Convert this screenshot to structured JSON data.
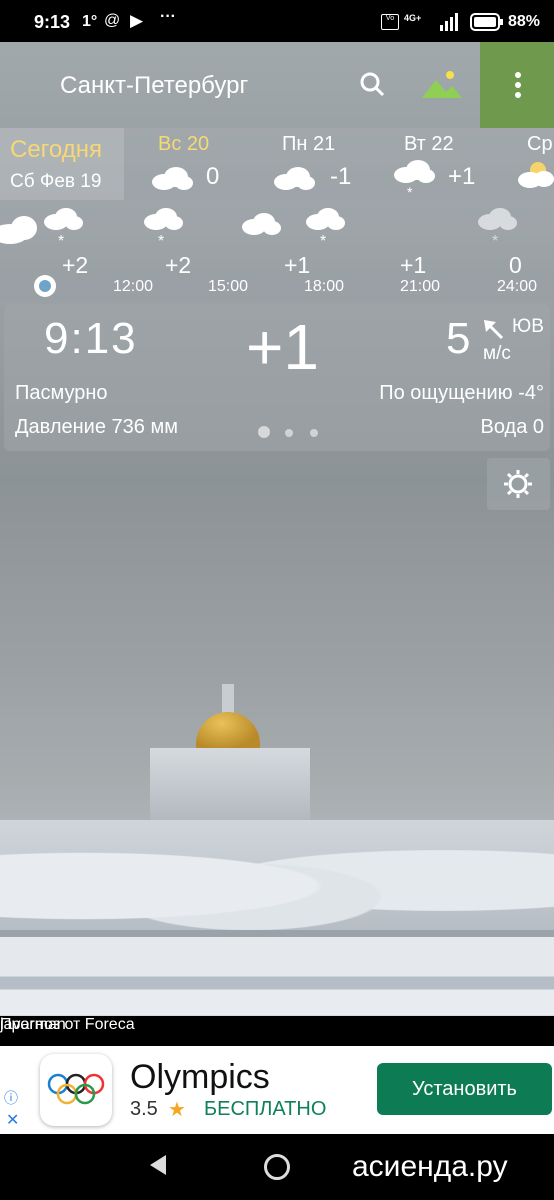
{
  "status_bar": {
    "time": "9:13",
    "temp_indicator": "1°",
    "more": "···",
    "network": "4G+",
    "battery": "88%"
  },
  "header": {
    "city": "Санкт-Петербург"
  },
  "days": [
    {
      "label": "Сегодня",
      "date": "Сб Фев 19"
    },
    {
      "label": "Вс 20",
      "temp": "0"
    },
    {
      "label": "Пн 21",
      "temp": "-1"
    },
    {
      "label": "Вт 22",
      "temp": "+1"
    },
    {
      "label": "Ср",
      "temp": ""
    }
  ],
  "hourly": {
    "temps": [
      "+2",
      "+2",
      "+1",
      "+1",
      "0"
    ],
    "times": [
      "12:00",
      "15:00",
      "18:00",
      "21:00",
      "24:00"
    ]
  },
  "current": {
    "time": "9:13",
    "temp": "+1",
    "wind_speed": "5",
    "wind_dir": "ЮВ",
    "wind_unit": "м/с",
    "condition": "Пасмурно",
    "feels_like": "По ощущению -4°",
    "pressure": "Давление 736 мм",
    "water": "Вода 0"
  },
  "credits": {
    "author": "javarman",
    "provider": "Прогноз от Foreca"
  },
  "ad": {
    "title": "Olympics",
    "rating": "3.5",
    "star": "★",
    "price": "БЕСПЛАТНО",
    "install": "Установить",
    "info_icon": "ⓘ",
    "close_icon": "✕"
  },
  "watermark": "асиенда.ру",
  "colors": {
    "accent_today": "#f6d874",
    "menu_bg": "#6f9a4e",
    "install_bg": "#0d7c55"
  }
}
